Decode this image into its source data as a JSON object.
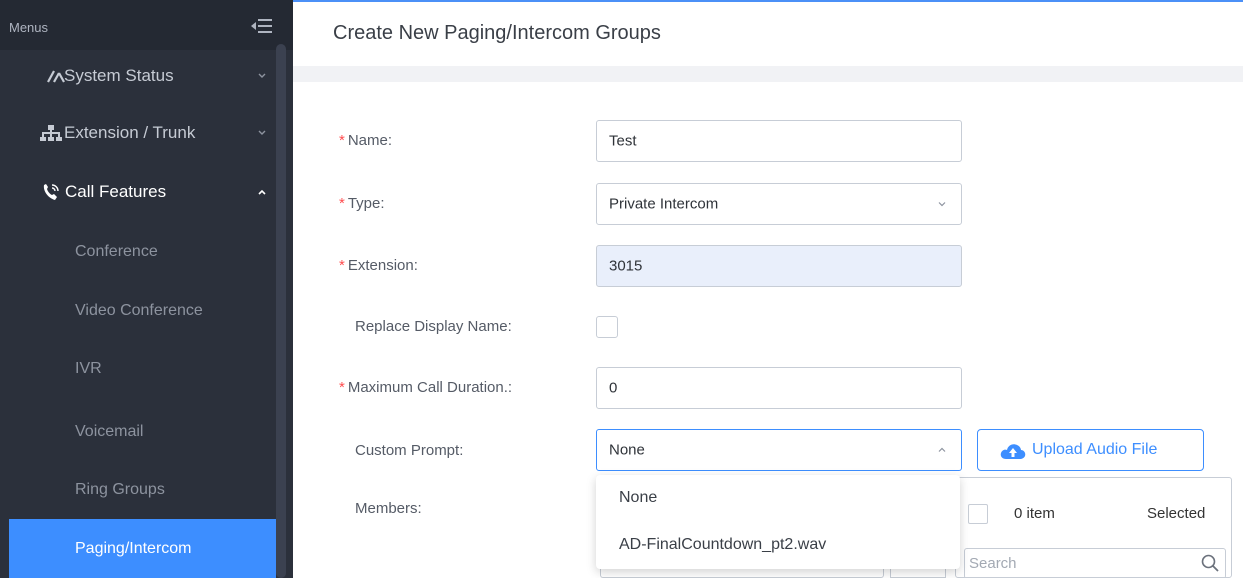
{
  "sidebar": {
    "menus_label": "Menus",
    "top_items": [
      {
        "label": "System Status",
        "icon": "gauge-icon"
      },
      {
        "label": "Extension / Trunk",
        "icon": "network-icon"
      },
      {
        "label": "Call Features",
        "icon": "phone-icon"
      }
    ],
    "sub_items": [
      {
        "label": "Conference"
      },
      {
        "label": "Video Conference"
      },
      {
        "label": "IVR"
      },
      {
        "label": "Voicemail"
      },
      {
        "label": "Ring Groups"
      },
      {
        "label": "Paging/Intercom"
      }
    ],
    "active_item": "Paging/Intercom"
  },
  "header": {
    "title": "Create New Paging/Intercom Groups"
  },
  "form": {
    "name": {
      "label": "Name:",
      "value": "Test",
      "required": true
    },
    "type": {
      "label": "Type:",
      "value": "Private Intercom",
      "required": true
    },
    "extension": {
      "label": "Extension:",
      "value": "3015",
      "required": true
    },
    "replace_display_name": {
      "label": "Replace Display Name:",
      "checked": false
    },
    "max_call_duration": {
      "label": "Maximum Call Duration.:",
      "value": "0",
      "required": true
    },
    "custom_prompt": {
      "label": "Custom Prompt:",
      "value": "None",
      "options": [
        "None",
        "AD-FinalCountdown_pt2.wav"
      ]
    },
    "upload_button": "Upload Audio File",
    "members": {
      "label": "Members:",
      "count": "0 item",
      "selected_label": "Selected",
      "search_placeholder": "Search"
    }
  },
  "colors": {
    "sidebar_bg": "#2b303b",
    "accent": "#3d8eff",
    "required": "#ff4d4f"
  }
}
